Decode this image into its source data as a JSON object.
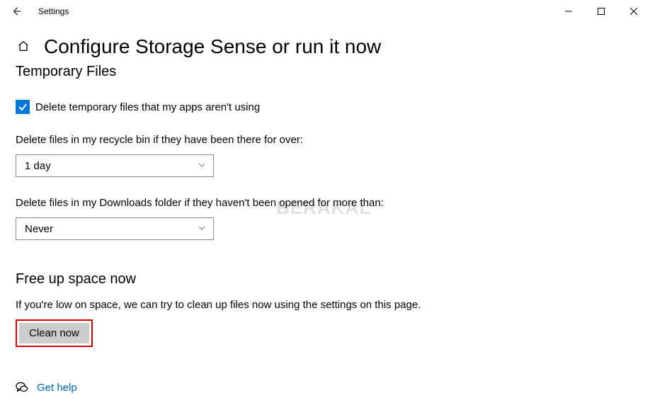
{
  "window": {
    "title": "Settings"
  },
  "page": {
    "title": "Configure Storage Sense or run it now"
  },
  "temp": {
    "heading": "Temporary Files",
    "checkbox_label": "Delete temporary files that my apps aren't using",
    "checkbox_checked": true,
    "recycle_label": "Delete files in my recycle bin if they have been there for over:",
    "recycle_value": "1 day",
    "downloads_label": "Delete files in my Downloads folder if they haven't been opened for more than:",
    "downloads_value": "Never"
  },
  "free": {
    "heading": "Free up space now",
    "text": "If you're low on space, we can try to clean up files now using the settings on this page.",
    "button": "Clean now"
  },
  "help": {
    "label": "Get help"
  },
  "watermark": "BERAKAL"
}
